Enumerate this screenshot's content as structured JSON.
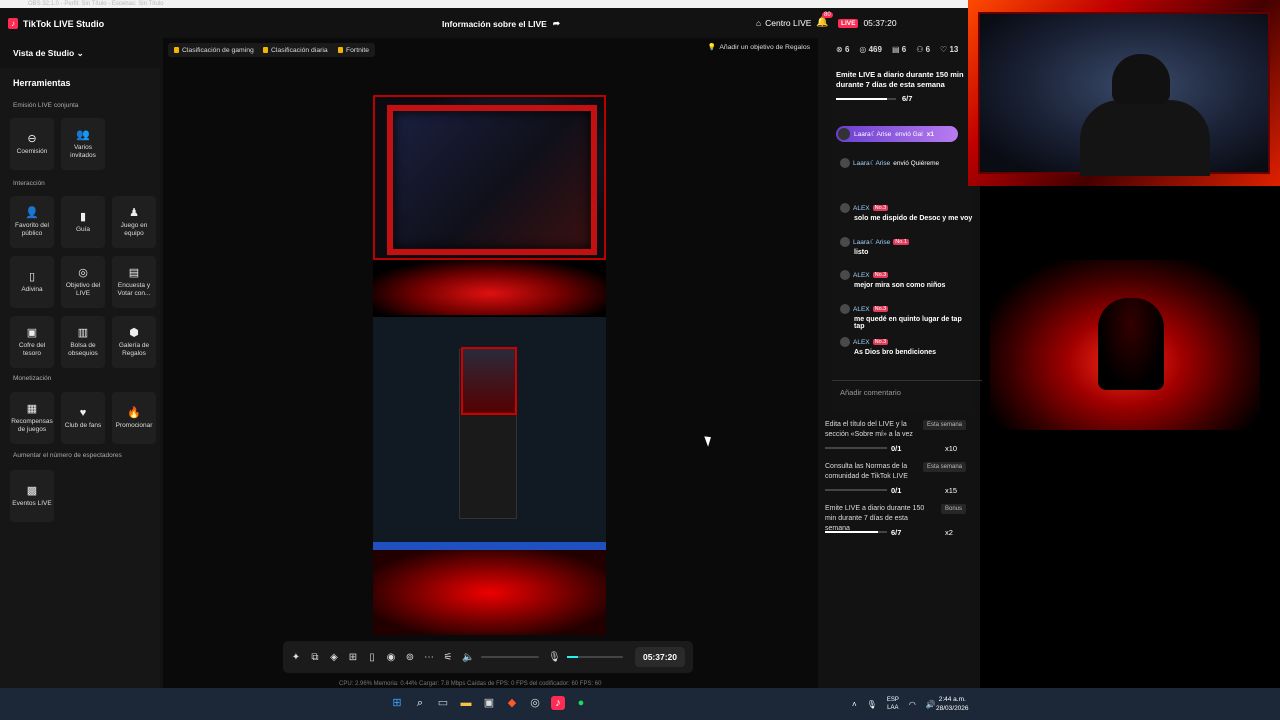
{
  "app": {
    "title": "TikTok LIVE Studio",
    "obs_title": "OBS 32.1.0 - Perfil: Sin Título - Escenas: Sin Título",
    "center_title": "Información sobre el LIVE",
    "centro_live": "Centro LIVE",
    "notif_count": "80",
    "live_label": "LIVE",
    "elapsed": "05:37:20"
  },
  "sidebar": {
    "vista": "Vista de Studio",
    "herramientas": "Herramientas",
    "sections": {
      "emision": "Emisión LIVE conjunta",
      "interaccion": "Interacción",
      "monetizacion": "Monetización",
      "aumentar": "Aumentar el número de espectadores"
    },
    "tools": {
      "coemision": "Coemisión",
      "varios": "Varios invitados",
      "favorito": "Favorito del público",
      "guia": "Guía",
      "juego": "Juego en equipo",
      "adivina": "Adivina",
      "objetivo": "Objetivo del LIVE",
      "encuesta": "Encuesta y Votar con...",
      "cofre": "Cofre del tesoro",
      "bolsa": "Bolsa de obsequios",
      "galeria": "Galería de Regalos",
      "recompensas": "Recompensas de juegos",
      "club": "Club de fans",
      "promocionar": "Promocionar",
      "eventos": "Eventos LIVE"
    }
  },
  "main": {
    "chips": [
      "Clasificación de gaming",
      "Clasificación diaria",
      "Fortnite"
    ],
    "goal_button": "Añadir un objetivo de Regalos",
    "timer": "05:37:20",
    "mic_level": 0.2,
    "stats": "CPU: 2.96%     Memoria: 0.44%     Cargar: 7.8 Mbps     Caídas de FPS: 0     FPS del codificador: 60     FPS: 60"
  },
  "metrics": {
    "viewers": "6",
    "likes": "469",
    "gifts": "6",
    "shares": "6",
    "hearts": "13"
  },
  "overlay_goal": {
    "title": "Emite LIVE a diario durante 150 min durante 7 días de esta semana",
    "progress": "6/7",
    "progress_value": 0.857
  },
  "gift": {
    "user": "Laara☾Arise",
    "text": "envió Gal",
    "mult": "x1"
  },
  "chat": [
    {
      "user": "Laara☾Arise",
      "level": "",
      "text": "envió Quiéreme"
    },
    {
      "user": "ALEX",
      "level": "No.3",
      "text": "solo me dispido de Desoc y me voy"
    },
    {
      "user": "Laara☾Arise",
      "level": "No.1",
      "text": "listo"
    },
    {
      "user": "ALEX",
      "level": "No.3",
      "text": "mejor mira son como niños"
    },
    {
      "user": "ALEX",
      "level": "No.3",
      "text": "me quedé en quinto lugar de tap tap"
    },
    {
      "user": "ALEX",
      "level": "No.3",
      "text": "As Dios bro bendiciones"
    }
  ],
  "add_comment": "Añadir comentario",
  "goals": [
    {
      "text": "Edita el título del LIVE y la sección «Sobre mí» a la vez",
      "badge": "Esta semana",
      "progress": "0/1",
      "progress_value": 0,
      "reward": "x10"
    },
    {
      "text": "Consulta las Normas de la comunidad de TikTok LIVE",
      "badge": "Esta semana",
      "progress": "0/1",
      "progress_value": 0,
      "reward": "x15"
    },
    {
      "text": "Emite LIVE a diario durante 150 min durante 7 días de esta semana",
      "badge": "Bonus",
      "progress": "6/7",
      "progress_value": 0.857,
      "reward": "x2"
    }
  ],
  "taskbar": {
    "lang1": "ESP",
    "lang2": "LAA",
    "time": "2:44 a.m.",
    "date": "28/03/2026"
  },
  "colors": {
    "accent": "#fe2c55",
    "panel": "#121212",
    "mic": "#25f4ee"
  }
}
